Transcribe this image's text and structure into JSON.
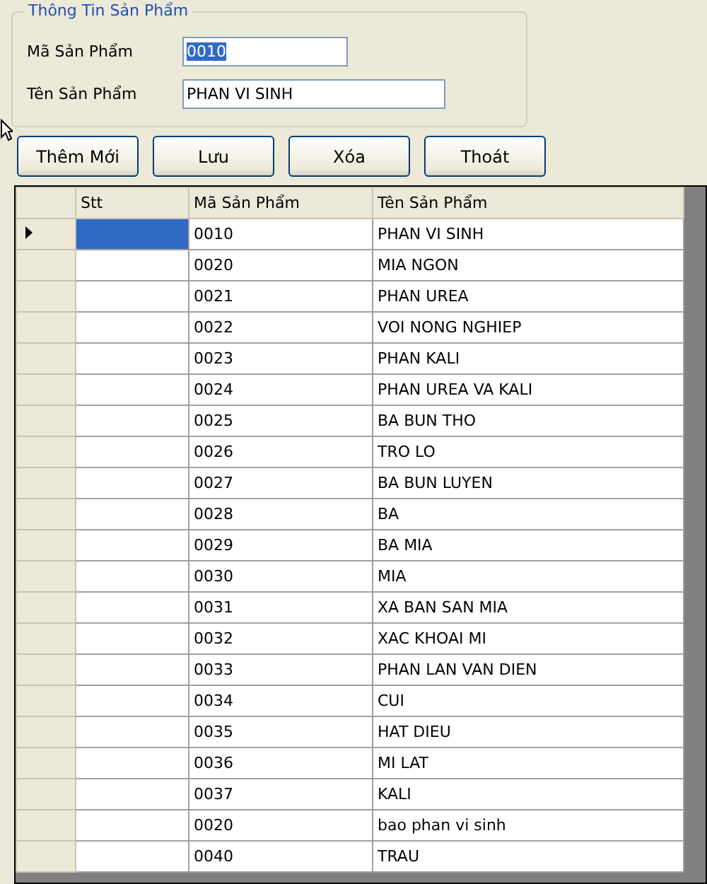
{
  "group": {
    "title": "Thông Tin Sản Phẩm",
    "fields": [
      {
        "label": "Mã Sản Phẩm",
        "value": "0010",
        "highlighted": true
      },
      {
        "label": "Tên Sản Phẩm",
        "value": "PHAN VI SINH",
        "highlighted": false
      }
    ]
  },
  "buttons": [
    "Thêm Mới",
    "Lưu",
    "Xóa",
    "Thoát"
  ],
  "table": {
    "columns": [
      "Stt",
      "Mã Sản Phẩm",
      "Tên Sản Phẩm"
    ],
    "rows": [
      {
        "code": "0010",
        "name": "PHAN VI SINH",
        "selected": true
      },
      {
        "code": "0020",
        "name": "MIA NGON",
        "selected": false
      },
      {
        "code": "0021",
        "name": "PHAN UREA",
        "selected": false
      },
      {
        "code": "0022",
        "name": "VOI NONG NGHIEP",
        "selected": false
      },
      {
        "code": "0023",
        "name": "PHAN KALI",
        "selected": false
      },
      {
        "code": "0024",
        "name": "PHAN UREA VA KALI",
        "selected": false
      },
      {
        "code": "0025",
        "name": "BA BUN THO",
        "selected": false
      },
      {
        "code": "0026",
        "name": "TRO LO",
        "selected": false
      },
      {
        "code": "0027",
        "name": "BA BUN LUYEN",
        "selected": false
      },
      {
        "code": "0028",
        "name": "BA",
        "selected": false
      },
      {
        "code": "0029",
        "name": "BA MIA",
        "selected": false
      },
      {
        "code": "0030",
        "name": "MIA",
        "selected": false
      },
      {
        "code": "0031",
        "name": "XA BAN SAN MIA",
        "selected": false
      },
      {
        "code": "0032",
        "name": "XAC KHOAI MI",
        "selected": false
      },
      {
        "code": "0033",
        "name": "PHAN LAN VAN DIEN",
        "selected": false
      },
      {
        "code": "0034",
        "name": "CUI",
        "selected": false
      },
      {
        "code": "0035",
        "name": "HAT DIEU",
        "selected": false
      },
      {
        "code": "0036",
        "name": "MI LAT",
        "selected": false
      },
      {
        "code": "0037",
        "name": "KALI",
        "selected": false
      },
      {
        "code": "0020",
        "name": "bao phan vi sinh",
        "selected": false
      },
      {
        "code": "0040",
        "name": "TRAU",
        "selected": false
      }
    ]
  }
}
